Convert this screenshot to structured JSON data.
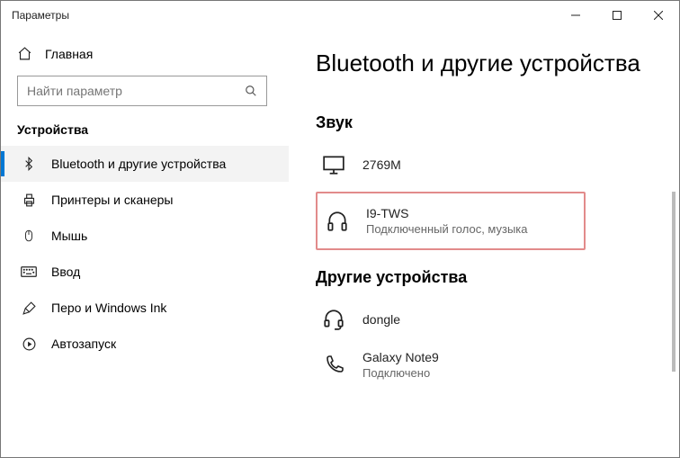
{
  "window": {
    "title": "Параметры"
  },
  "sidebar": {
    "home": "Главная",
    "search_placeholder": "Найти параметр",
    "heading": "Устройства",
    "items": [
      {
        "label": "Bluetooth и другие устройства"
      },
      {
        "label": "Принтеры и сканеры"
      },
      {
        "label": "Мышь"
      },
      {
        "label": "Ввод"
      },
      {
        "label": "Перо и Windows Ink"
      },
      {
        "label": "Автозапуск"
      }
    ]
  },
  "content": {
    "page_title": "Bluetooth и другие устройства",
    "sections": {
      "audio_title": "Звук",
      "other_title": "Другие устройства"
    },
    "devices": {
      "monitor": {
        "name": "2769M"
      },
      "headphones": {
        "name": "I9-TWS",
        "status": "Подключенный голос, музыка"
      },
      "dongle": {
        "name": "dongle"
      },
      "phone": {
        "name": "Galaxy Note9",
        "status": "Подключено"
      }
    }
  }
}
